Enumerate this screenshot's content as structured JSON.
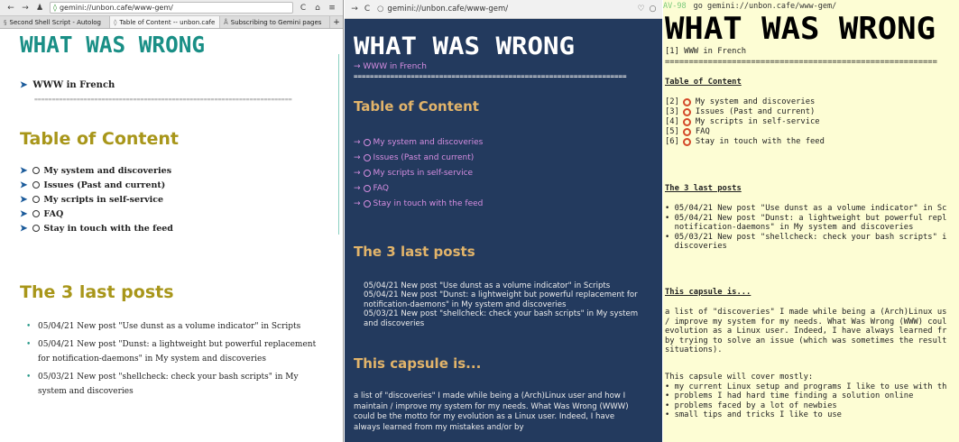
{
  "logo_text": "WHAT WAS WRONG",
  "panel1": {
    "nav": {
      "back": "←",
      "forward": "→",
      "url": "gemini://unbon.cafe/www-gem/",
      "reload": "C",
      "home": "⌂",
      "menu": "≡"
    },
    "tabs": [
      {
        "label": "Second Shell Script - Autolog",
        "active": false
      },
      {
        "label": "Table of Content -- unbon.cafe",
        "active": true
      },
      {
        "label": "Subscribing to Gemini pages",
        "active": false
      }
    ],
    "new_tab": "+",
    "www_link": "WWW in French",
    "separator": "=========================================================================",
    "toc_title": "Table of Content",
    "toc": [
      "My system and discoveries",
      "Issues (Past and current)",
      "My scripts in self-service",
      "FAQ",
      "Stay in touch with the feed"
    ],
    "last_title": "The 3 last posts",
    "posts": [
      "05/04/21 New post \"Use dunst as a volume indicator\" in Scripts",
      "05/04/21 New post \"Dunst: a lightweight but powerful replacement for notification-daemons\" in My system and discoveries",
      "05/03/21 New post \"shellcheck: check your bash scripts\" in My system and discoveries"
    ]
  },
  "panel2": {
    "nav": {
      "back": "→",
      "reload": "C",
      "url": "gemini://unbon.cafe/www-gem/",
      "heart": "♡",
      "circle": "○"
    },
    "www_link": "→ WWW in French",
    "separator": "===================================================================",
    "toc_title": "Table of Content",
    "toc": [
      "My system and discoveries",
      "Issues (Past and current)",
      "My scripts in self-service",
      "FAQ",
      "Stay in touch with the feed"
    ],
    "last_title": "The 3 last posts",
    "posts": "05/04/21 New post \"Use dunst as a volume indicator\" in Scripts\n05/04/21 New post \"Dunst: a lightweight but powerful replacement for notification-daemons\" in My system and discoveries\n05/03/21 New post \"shellcheck: check your bash scripts\" in My system and discoveries",
    "capsule_title": "This capsule is...",
    "capsule_text": "a list of \"discoveries\" I made while being a (Arch)Linux user and how I maintain / improve my system for my needs. What Was Wrong (WWW) could be the motto for my evolution as a Linux user. Indeed, I have always learned from my mistakes and/or by"
  },
  "panel3": {
    "prompt": "AV-98",
    "command": "go gemini://unbon.cafe/www-gem/",
    "www_line": "[1] WWW in French",
    "separator": "=========================================================",
    "toc_title": "Table of Content",
    "toc": [
      {
        "num": "[2]",
        "label": "My system and discoveries"
      },
      {
        "num": "[3]",
        "label": "Issues (Past and current)"
      },
      {
        "num": "[4]",
        "label": "My scripts in self-service"
      },
      {
        "num": "[5]",
        "label": "FAQ"
      },
      {
        "num": "[6]",
        "label": "Stay in touch with the feed"
      }
    ],
    "last_title": "The 3 last posts",
    "posts": "• 05/04/21 New post \"Use dunst as a volume indicator\" in Sc\n• 05/04/21 New post \"Dunst: a lightweight but powerful repl\n  notification-daemons\" in My system and discoveries\n• 05/03/21 New post \"shellcheck: check your bash scripts\" i\n  discoveries",
    "capsule_title": "This capsule is...",
    "capsule_text": "a list of \"discoveries\" I made while being a (Arch)Linux us\n/ improve my system for my needs. What Was Wrong (WWW) coul\nevolution as a Linux user. Indeed, I have always learned fr\nby trying to solve an issue (which was sometimes the result\nsituations).",
    "cover_text": "This capsule will cover mostly:\n• my current Linux setup and programs I like to use with th\n• problems I had hard time finding a solution online\n• problems faced by a lot of newbies\n• small tips and tricks I like to use"
  },
  "colors": {
    "p1_heading": "#a8961a",
    "p2_bg": "#233a5e",
    "p2_link": "#d58de0",
    "p2_heading": "#e2b46a",
    "p3_bg": "#fdfdd4",
    "p3_circle": "#d44a2a",
    "logo_teal": "#1a8f86"
  }
}
